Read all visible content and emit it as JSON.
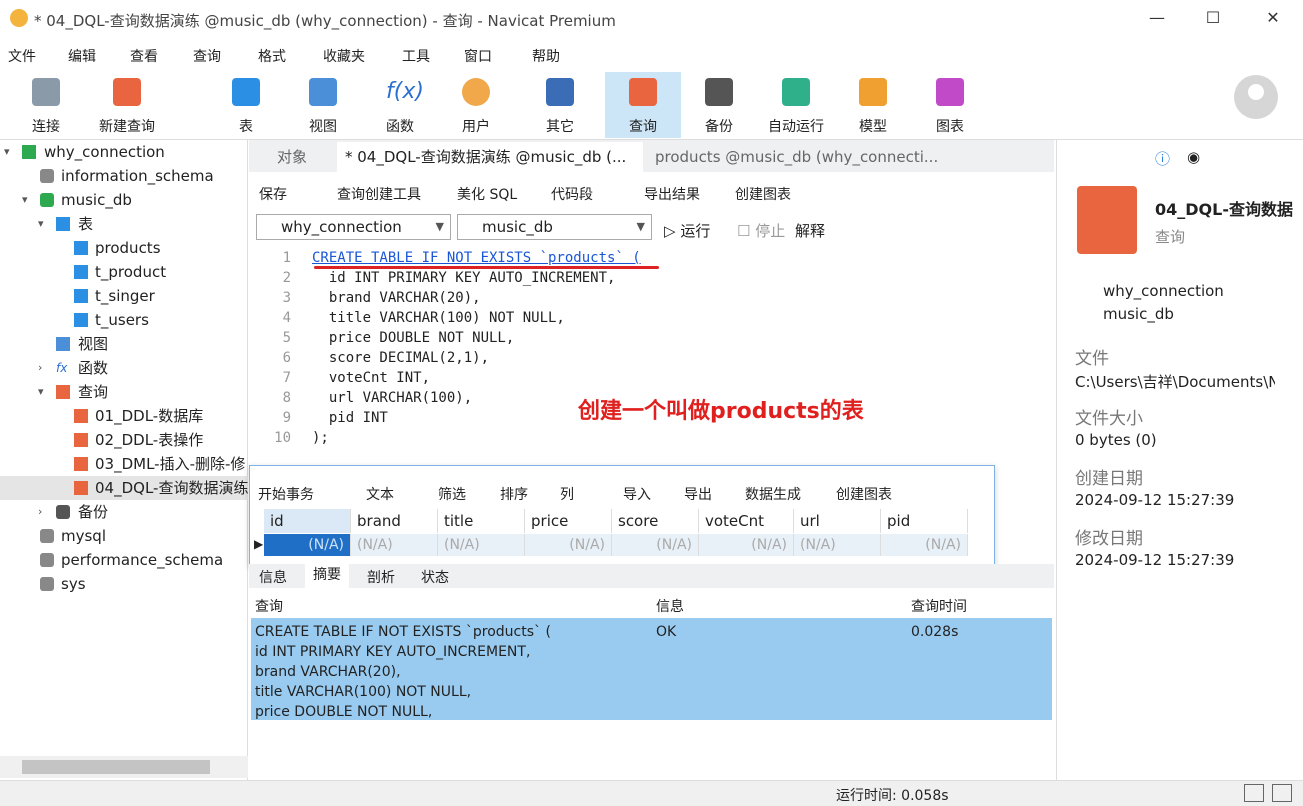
{
  "window": {
    "title": "* 04_DQL-查询数据演练 @music_db (why_connection) - 查询 - Navicat Premium",
    "minimize": "—",
    "maximize": "☐",
    "close": "✕"
  },
  "menu": [
    "文件",
    "编辑",
    "查看",
    "查询",
    "格式",
    "收藏夹",
    "工具",
    "窗口",
    "帮助"
  ],
  "toolbar": [
    {
      "label": "连接",
      "icon": "connection-plug-icon"
    },
    {
      "label": "新建查询",
      "icon": "new-query-icon"
    },
    {
      "label": "表",
      "icon": "table-icon"
    },
    {
      "label": "视图",
      "icon": "view-icon"
    },
    {
      "label": "函数",
      "icon": "function-icon"
    },
    {
      "label": "用户",
      "icon": "user-icon"
    },
    {
      "label": "其它",
      "icon": "tools-icon"
    },
    {
      "label": "查询",
      "icon": "query-icon"
    },
    {
      "label": "备份",
      "icon": "backup-icon"
    },
    {
      "label": "自动运行",
      "icon": "robot-icon"
    },
    {
      "label": "模型",
      "icon": "model-icon"
    },
    {
      "label": "图表",
      "icon": "chart-icon"
    }
  ],
  "tree": [
    {
      "label": "why_connection"
    },
    {
      "label": "information_schema"
    },
    {
      "label": "music_db"
    },
    {
      "label": "表"
    },
    {
      "label": "products"
    },
    {
      "label": "t_product"
    },
    {
      "label": "t_singer"
    },
    {
      "label": "t_users"
    },
    {
      "label": "视图"
    },
    {
      "label": "函数"
    },
    {
      "label": "查询"
    },
    {
      "label": "01_DDL-数据库"
    },
    {
      "label": "02_DDL-表操作"
    },
    {
      "label": "03_DML-插入-删除-修"
    },
    {
      "label": "04_DQL-查询数据演练"
    },
    {
      "label": "备份"
    },
    {
      "label": "mysql"
    },
    {
      "label": "performance_schema"
    },
    {
      "label": "sys"
    }
  ],
  "tabs": {
    "objects": "对象",
    "active": "* 04_DQL-查询数据演练 @music_db (...",
    "other": "products @music_db (why_connecti..."
  },
  "querytool": {
    "save": "保存",
    "builder": "查询创建工具",
    "beautify": "美化 SQL",
    "snippet": "代码段",
    "export": "导出结果",
    "chart": "创建图表"
  },
  "combos": {
    "connection": "why_connection",
    "database": "music_db",
    "run": "运行",
    "stop": "停止",
    "explain": "解释"
  },
  "editor": {
    "lines": [
      "CREATE TABLE IF NOT EXISTS `products` (",
      "  id INT PRIMARY KEY AUTO_INCREMENT,",
      "  brand VARCHAR(20),",
      "  title VARCHAR(100) NOT NULL,",
      "  price DOUBLE NOT NULL,",
      "  score DECIMAL(2,1),",
      "  voteCnt INT,",
      "  url VARCHAR(100),",
      "  pid INT",
      ");"
    ],
    "nums": [
      "1",
      "2",
      "3",
      "4",
      "5",
      "6",
      "7",
      "8",
      "9",
      "10"
    ]
  },
  "annotation": "创建一个叫做products的表",
  "result": {
    "toolbar": {
      "begin": "开始事务",
      "text": "文本",
      "filter": "筛选",
      "sort": "排序",
      "cols": "列",
      "import": "导入",
      "export": "导出",
      "gen": "数据生成",
      "chart": "创建图表"
    },
    "columns": [
      "id",
      "brand",
      "title",
      "price",
      "score",
      "voteCnt",
      "url",
      "pid"
    ],
    "cells": [
      "(N/A)",
      "(N/A)",
      "(N/A)",
      "(N/A)",
      "(N/A)",
      "(N/A)",
      "(N/A)",
      "(N/A)"
    ]
  },
  "bottomtabs": [
    "信息",
    "摘要",
    "剖析",
    "状态"
  ],
  "log": {
    "headers": [
      "查询",
      "信息",
      "查询时间"
    ],
    "query": "CREATE TABLE IF NOT EXISTS `products` (\nid INT PRIMARY KEY AUTO_INCREMENT,\nbrand VARCHAR(20),\ntitle VARCHAR(100) NOT NULL,\nprice DOUBLE NOT NULL,",
    "info": "OK",
    "time": "0.028s"
  },
  "right": {
    "name": "04_DQL-查询数据",
    "type": "查询",
    "conn": "why_connection",
    "db": "music_db",
    "file_label": "文件",
    "file": "C:\\Users\\吉祥\\Documents\\N",
    "size_label": "文件大小",
    "size": "0 bytes (0)",
    "created_label": "创建日期",
    "created": "2024-09-12 15:27:39",
    "modified_label": "修改日期",
    "modified": "2024-09-12 15:27:39"
  },
  "status": {
    "runtime": "运行时间: 0.058s"
  }
}
